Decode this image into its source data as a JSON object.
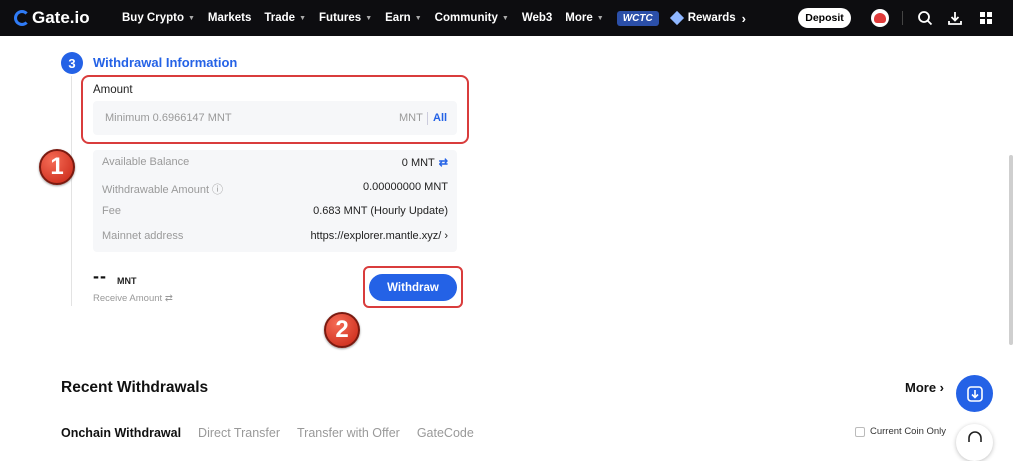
{
  "nav": {
    "logo": "Gate.io",
    "items": [
      {
        "label": "Buy Crypto",
        "caret": true
      },
      {
        "label": "Markets",
        "caret": false
      },
      {
        "label": "Trade",
        "caret": true
      },
      {
        "label": "Futures",
        "caret": true
      },
      {
        "label": "Earn",
        "caret": true
      },
      {
        "label": "Community",
        "caret": true
      },
      {
        "label": "Web3",
        "caret": false
      },
      {
        "label": "More",
        "caret": true
      }
    ],
    "wctc": "WCTC",
    "rewards": "Rewards",
    "deposit": "Deposit"
  },
  "withdrawal": {
    "step_number": "3",
    "title": "Withdrawal Information",
    "amount_label": "Amount",
    "amount_placeholder": "Minimum 0.6966147 MNT",
    "amount_unit": "MNT",
    "all_label": "All",
    "info": [
      {
        "key": "Available Balance",
        "value": "0 MNT",
        "swap": true
      },
      {
        "key": "Withdrawable Amount ⓘ",
        "value": "0.00000000 MNT",
        "swap": false
      },
      {
        "key": "Fee",
        "value": "0.683 MNT (Hourly Update)",
        "swap": false
      },
      {
        "key": "Mainnet address",
        "value": "https://explorer.mantle.xyz/  ›",
        "swap": false
      }
    ],
    "receive_value": "--",
    "receive_unit": "MNT",
    "receive_label": "Receive Amount ⇄",
    "withdraw_button": "Withdraw"
  },
  "annotations": {
    "badge1": "1",
    "badge2": "2"
  },
  "recent": {
    "title": "Recent Withdrawals",
    "more": "More ›",
    "tabs": [
      "Onchain Withdrawal",
      "Direct Transfer",
      "Transfer with Offer",
      "GateCode"
    ],
    "current_coin_only": "Current Coin Only"
  }
}
